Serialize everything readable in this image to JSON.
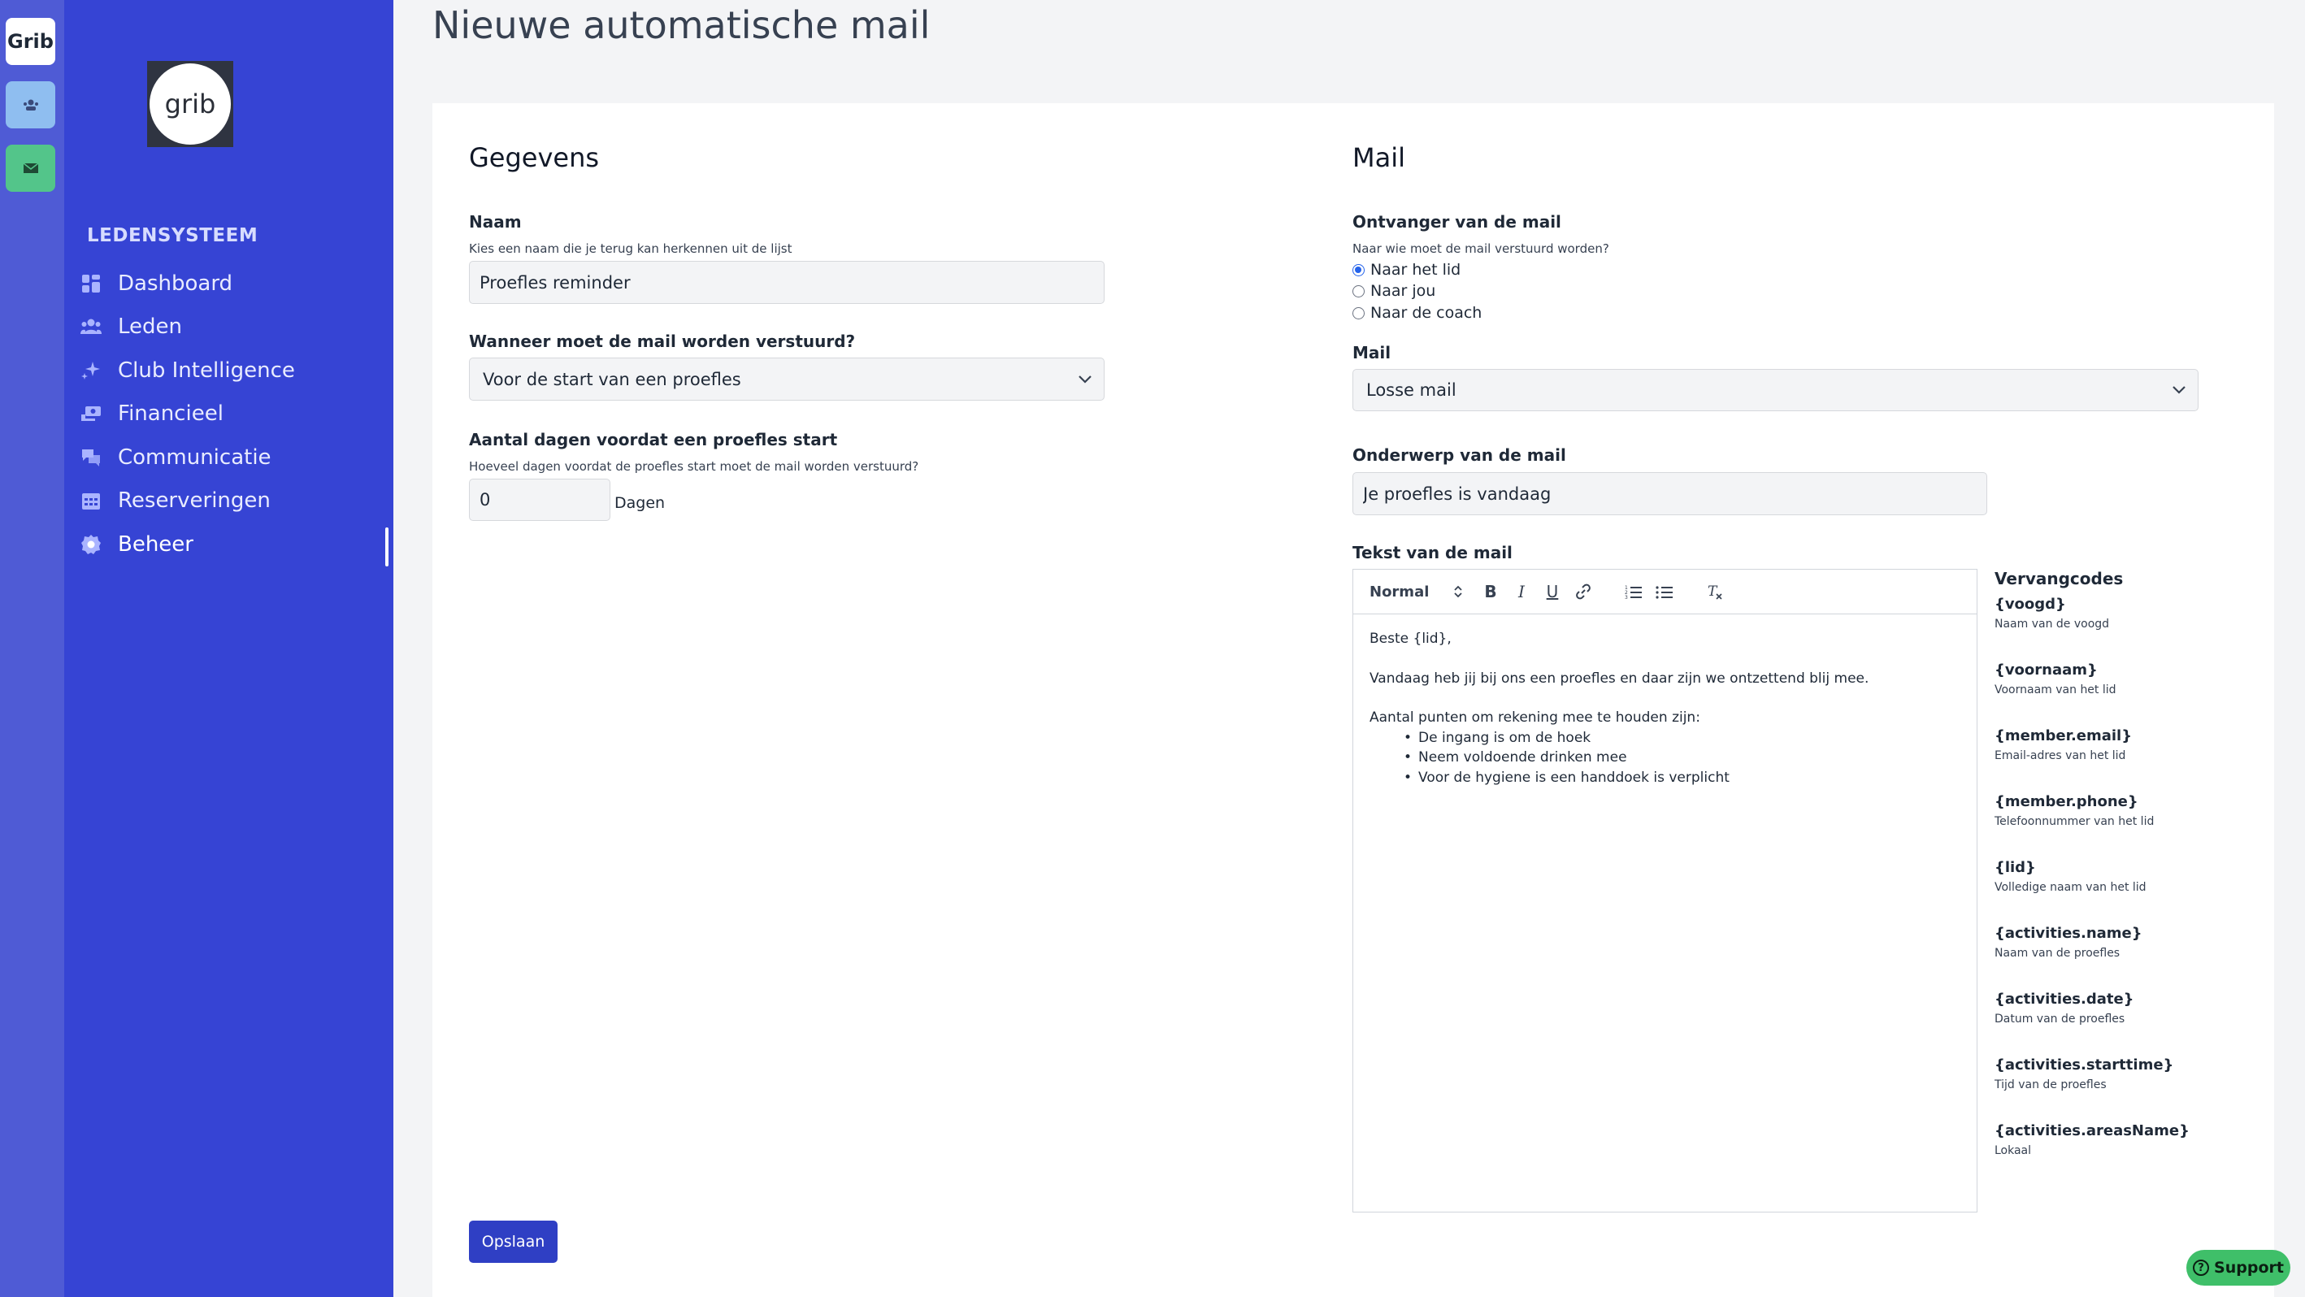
{
  "rail": {
    "org_label": "Grib"
  },
  "brand": {
    "logo_text": "grib",
    "section_title": "LEDENSYSTEEM"
  },
  "nav": [
    {
      "label": "Dashboard",
      "icon": "grid-icon"
    },
    {
      "label": "Leden",
      "icon": "users-icon"
    },
    {
      "label": "Club Intelligence",
      "icon": "sparkles-icon"
    },
    {
      "label": "Financieel",
      "icon": "money-icon"
    },
    {
      "label": "Communicatie",
      "icon": "chat-icon"
    },
    {
      "label": "Reserveringen",
      "icon": "calendar-icon"
    },
    {
      "label": "Beheer",
      "icon": "gear-icon",
      "active": true
    }
  ],
  "page": {
    "title": "Nieuwe automatische mail"
  },
  "gegevens": {
    "heading": "Gegevens",
    "naam_label": "Naam",
    "naam_help": "Kies een naam die je terug kan herkennen uit de lijst",
    "naam_value": "Proefles reminder",
    "wanneer_label": "Wanneer moet de mail worden verstuurd?",
    "wanneer_value": "Voor de start van een proefles",
    "dagen_label": "Aantal dagen voordat een proefles start",
    "dagen_help": "Hoeveel dagen voordat de proefles start moet de mail worden verstuurd?",
    "dagen_value": "0",
    "dagen_unit": "Dagen"
  },
  "mail": {
    "heading": "Mail",
    "ontvanger_label": "Ontvanger van de mail",
    "ontvanger_help": "Naar wie moet de mail verstuurd worden?",
    "ontvanger_options": [
      "Naar het lid",
      "Naar jou",
      "Naar de coach"
    ],
    "ontvanger_selected": "Naar het lid",
    "mail_label": "Mail",
    "mail_value": "Losse mail",
    "onderwerp_label": "Onderwerp van de mail",
    "onderwerp_value": "Je proefles is vandaag",
    "tekst_label": "Tekst van de mail"
  },
  "editor": {
    "format_value": "Normal",
    "greeting": "Beste {lid},",
    "line1": "Vandaag heb jij bij ons een proefles en daar zijn we ontzettend blij mee.",
    "line2": "Aantal punten om rekening mee te houden zijn:",
    "bullets": [
      "De ingang is om de hoek",
      "Neem voldoende drinken mee",
      "Voor de hygiene is een handdoek is verplicht"
    ]
  },
  "codes": {
    "title": "Vervangcodes",
    "items": [
      {
        "code": "{voogd}",
        "desc": "Naam van de voogd"
      },
      {
        "code": "{voornaam}",
        "desc": "Voornaam van het lid"
      },
      {
        "code": "{member.email}",
        "desc": "Email-adres van het lid"
      },
      {
        "code": "{member.phone}",
        "desc": "Telefoonnummer van het lid"
      },
      {
        "code": "{lid}",
        "desc": "Volledige naam van het lid"
      },
      {
        "code": "{activities.name}",
        "desc": "Naam van de proefles"
      },
      {
        "code": "{activities.date}",
        "desc": "Datum van de proefles"
      },
      {
        "code": "{activities.starttime}",
        "desc": "Tijd van de proefles"
      },
      {
        "code": "{activities.areasName}",
        "desc": "Lokaal"
      }
    ]
  },
  "actions": {
    "save_label": "Opslaan",
    "support_label": "Support"
  },
  "colors": {
    "sidebar": "#3644d4",
    "rail": "#4f5bd5",
    "primary_button": "#2f3fc4",
    "support": "#3fbf69"
  }
}
